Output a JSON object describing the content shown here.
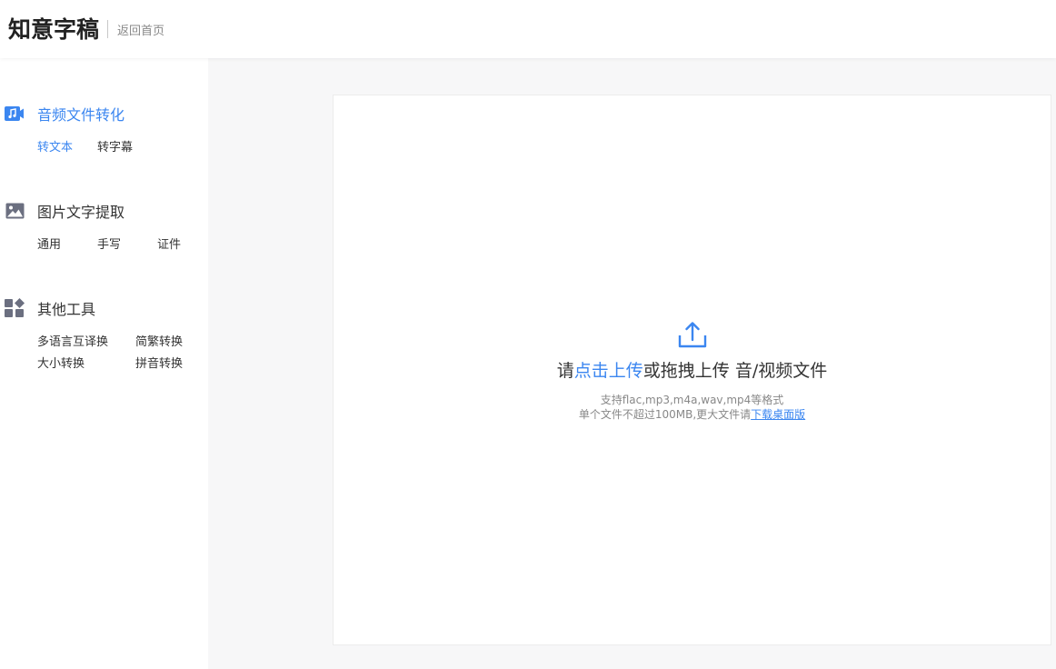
{
  "header": {
    "logo": "知意字稿",
    "back_label": "返回首页"
  },
  "sidebar": {
    "sections": [
      {
        "title": "音频文件转化",
        "icon": "audio-file-icon",
        "items": [
          "转文本",
          "转字幕"
        ]
      },
      {
        "title": "图片文字提取",
        "icon": "image-icon",
        "items": [
          "通用",
          "手写",
          "证件"
        ]
      },
      {
        "title": "其他工具",
        "icon": "tools-grid-icon",
        "items": [
          "多语言互译换",
          "简繁转换",
          "大小转换",
          "拼音转换"
        ]
      }
    ]
  },
  "upload": {
    "prefix": "请",
    "link_text": "点击上传",
    "suffix": "或拖拽上传 音/视频文件",
    "formats_hint": "支持flac,mp3,m4a,wav,mp4等格式",
    "size_hint": "单个文件不超过100MB,更大文件请",
    "desktop_link": "下载桌面版",
    "icon": "upload-icon"
  },
  "colors": {
    "accent": "#3b86f0",
    "icon_gray": "#6b6f80"
  }
}
